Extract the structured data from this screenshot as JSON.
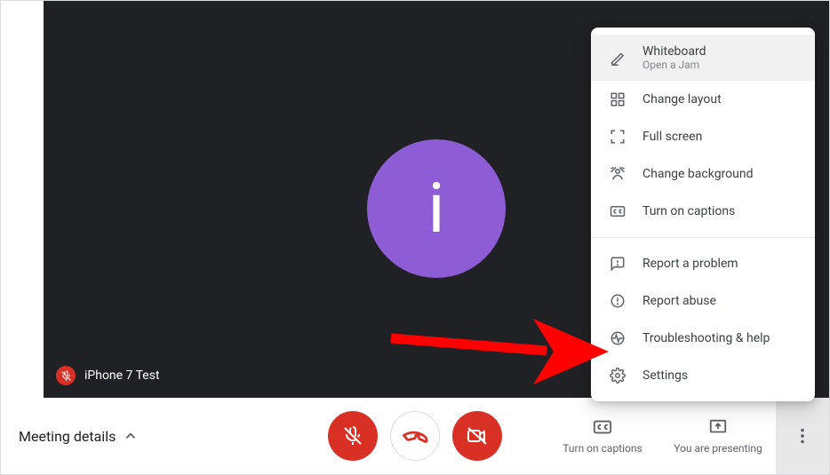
{
  "participant": {
    "name": "iPhone 7 Test",
    "avatar_letter": "i"
  },
  "bottom": {
    "meeting_details": "Meeting details",
    "captions": "Turn on captions",
    "presenting": "You are presenting"
  },
  "menu": {
    "whiteboard": {
      "label": "Whiteboard",
      "sub": "Open a Jam"
    },
    "change_layout": "Change layout",
    "full_screen": "Full screen",
    "change_background": "Change background",
    "turn_on_captions": "Turn on captions",
    "report_problem": "Report a problem",
    "report_abuse": "Report abuse",
    "troubleshooting": "Troubleshooting & help",
    "settings": "Settings"
  },
  "colors": {
    "red": "#d93025",
    "purple": "#8e5dd5",
    "arrow": "#ff0000"
  }
}
